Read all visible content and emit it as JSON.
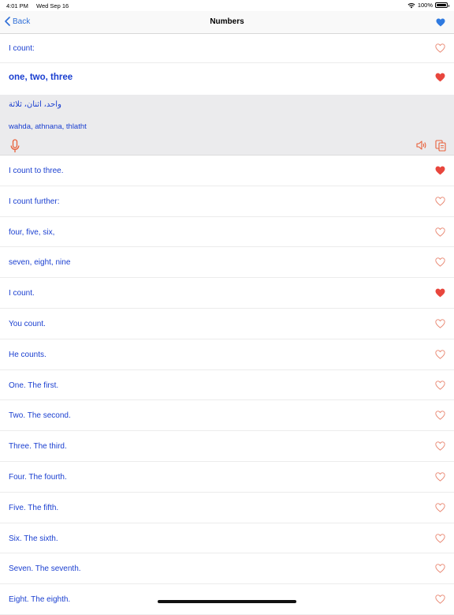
{
  "status": {
    "time": "4:01 PM",
    "date": "Wed Sep 16",
    "battery": "100%"
  },
  "nav": {
    "back_label": "Back",
    "title": "Numbers"
  },
  "first_row": {
    "text": "I count:",
    "favorited": false
  },
  "selected": {
    "text": "one, two, three",
    "favorited": true,
    "arabic": "واحد، اثنان، ثلاثة",
    "transliteration": "wahda, athnana, thlatht"
  },
  "rows": [
    {
      "text": "I count to three.",
      "favorited": true
    },
    {
      "text": "I count further:",
      "favorited": false
    },
    {
      "text": "four, five, six,",
      "favorited": false
    },
    {
      "text": "seven, eight, nine",
      "favorited": false
    },
    {
      "text": "I count.",
      "favorited": true
    },
    {
      "text": "You count.",
      "favorited": false
    },
    {
      "text": "He counts.",
      "favorited": false
    },
    {
      "text": "One. The first.",
      "favorited": false
    },
    {
      "text": "Two. The second.",
      "favorited": false
    },
    {
      "text": "Three. The third.",
      "favorited": false
    },
    {
      "text": "Four. The fourth.",
      "favorited": false
    },
    {
      "text": "Five. The fifth.",
      "favorited": false
    },
    {
      "text": "Six. The sixth.",
      "favorited": false
    },
    {
      "text": "Seven. The seventh.",
      "favorited": false
    },
    {
      "text": "Eight. The eighth.",
      "favorited": false
    }
  ],
  "colors": {
    "text": "#1a3fd0",
    "heart_filled": "#e8463d",
    "heart_outline": "#e8846e",
    "accent_blue": "#2f6fd8",
    "icon_orange": "#e8603a"
  }
}
